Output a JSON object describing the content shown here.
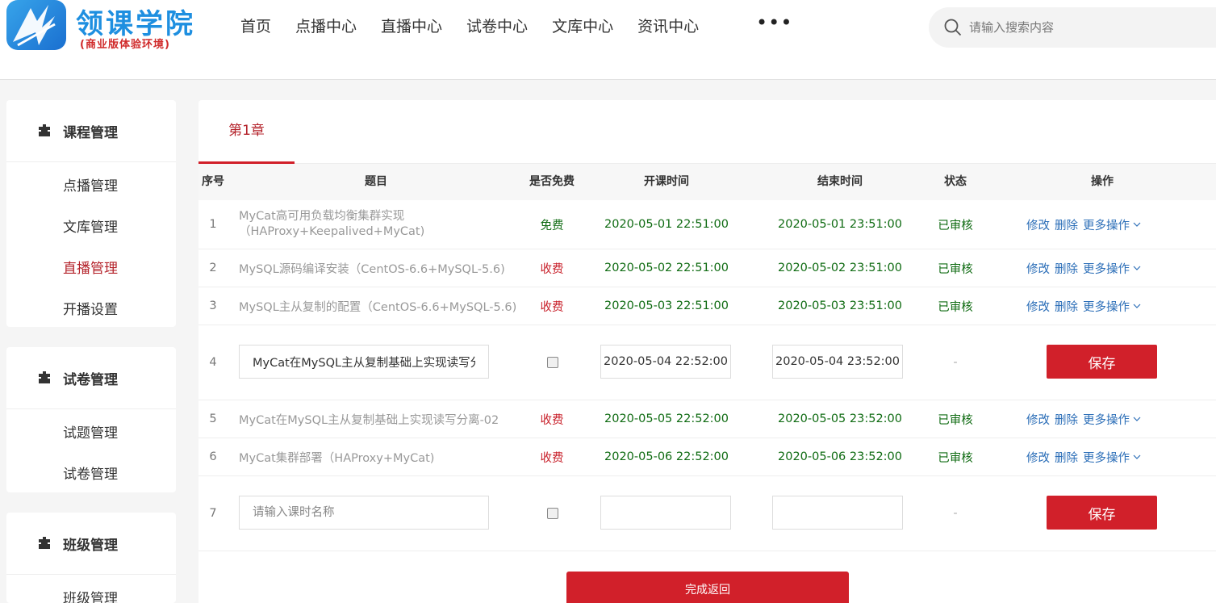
{
  "header": {
    "logo_title": "领课学院",
    "logo_subtitle": "(商业版体验环境)",
    "nav": [
      "首页",
      "点播中心",
      "直播中心",
      "试卷中心",
      "文库中心",
      "资讯中心"
    ],
    "nav_more": "•••",
    "search_placeholder": "请输入搜索内容"
  },
  "sidebar": {
    "course": {
      "title": "课程管理",
      "items": [
        "点播管理",
        "文库管理",
        "直播管理",
        "开播设置"
      ],
      "active": "直播管理"
    },
    "exam": {
      "title": "试卷管理",
      "items": [
        "试题管理",
        "试卷管理"
      ]
    },
    "klass": {
      "title": "班级管理",
      "items": [
        "班级管理"
      ]
    }
  },
  "main": {
    "tab": "第1章",
    "columns": [
      "序号",
      "题目",
      "是否免费",
      "开课时间",
      "结束时间",
      "状态",
      "操作"
    ],
    "ops": {
      "edit": "修改",
      "delete": "删除",
      "more": "更多操作"
    },
    "rows": [
      {
        "idx": "1",
        "title_line1": "MyCat高可用负载均衡集群实现",
        "title_line2": "（HAProxy+Keepalived+MyCat)",
        "free": "免费",
        "start": "2020-05-01  22:51:00",
        "end": "2020-05-01  23:51:00",
        "status": "已审核"
      },
      {
        "idx": "2",
        "title": "MySQL源码编译安装（CentOS-6.6+MySQL-5.6)",
        "free": "收费",
        "start": "2020-05-02  22:51:00",
        "end": "2020-05-02  23:51:00",
        "status": "已审核"
      },
      {
        "idx": "3",
        "title": "MySQL主从复制的配置（CentOS-6.6+MySQL-5.6)",
        "free": "收费",
        "start": "2020-05-03  22:51:00",
        "end": "2020-05-03  23:51:00",
        "status": "已审核"
      },
      {
        "idx": "4",
        "title_value": "MyCat在MySQL主从复制基础上实现读写分离",
        "start_value": "2020-05-04 22:52:00",
        "end_value": "2020-05-04 23:52:00",
        "status": "-",
        "save": "保存"
      },
      {
        "idx": "5",
        "title": "MyCat在MySQL主从复制基础上实现读写分离-02",
        "free": "收费",
        "start": "2020-05-05  22:52:00",
        "end": "2020-05-05  23:52:00",
        "status": "已审核"
      },
      {
        "idx": "6",
        "title": "MyCat集群部署（HAProxy+MyCat)",
        "free": "收费",
        "start": "2020-05-06  22:52:00",
        "end": "2020-05-06  23:52:00",
        "status": "已审核"
      },
      {
        "idx": "7",
        "title_placeholder": "请输入课时名称",
        "status": "-",
        "save": "保存"
      }
    ],
    "done_button": "完成返回"
  },
  "colors": {
    "brand_red": "#d1202a",
    "green": "#0f6b12",
    "link_blue": "#2d6fb8",
    "logo_blue": "#1e8fe0"
  }
}
